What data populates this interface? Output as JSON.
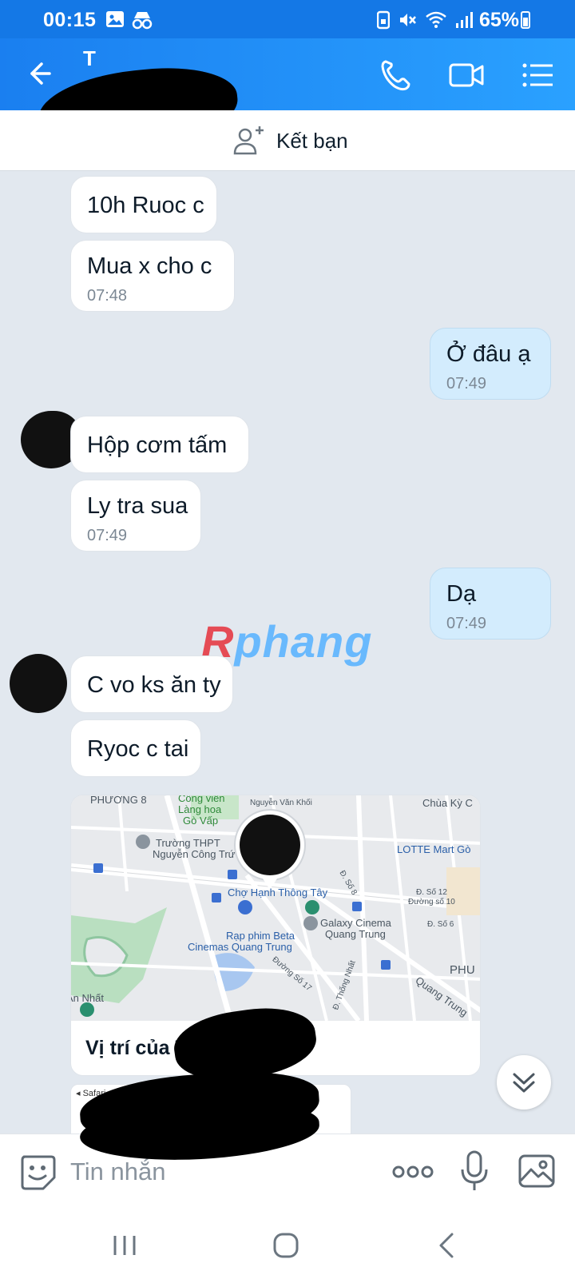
{
  "status_bar": {
    "time": "00:15",
    "battery": "65%"
  },
  "header": {
    "contact_name": "T"
  },
  "friend_bar": {
    "label": "Kết bạn"
  },
  "messages": [
    {
      "dir": "in",
      "text": "10h Ruoc c",
      "time": ""
    },
    {
      "dir": "in",
      "text": "Mua x cho c",
      "time": "07:48"
    },
    {
      "dir": "out",
      "text": "Ở đâu ạ",
      "time": "07:49"
    },
    {
      "dir": "in",
      "text": "Hộp cơm tấm",
      "time": ""
    },
    {
      "dir": "in",
      "text": "Ly tra sua",
      "time": "07:49"
    },
    {
      "dir": "out",
      "text": "Dạ",
      "time": "07:49"
    },
    {
      "dir": "in",
      "text": "C vo ks ăn ty",
      "time": ""
    },
    {
      "dir": "in",
      "text": "Ryoc c tai",
      "time": ""
    }
  ],
  "location_card": {
    "caption": "Vị trí của T",
    "map_labels": {
      "phuong8": "PHƯỜNG 8",
      "cong_vien": "Công viên",
      "lang_hoa": "Làng hoa",
      "go_vap": "Gò Vấp",
      "nguyen_van_khoi": "Nguyễn Văn Khối",
      "chua_ky_c": "Chùa Kỳ C",
      "truong_thpt": "Trường THPT",
      "nguyen_cong_tru": "Nguyễn Công Trứ",
      "lotte": "LOTTE Mart Gò",
      "cho_hong_tay": "Chợ Hạnh Thông Tây",
      "duong_so8": "Đ. Số 8",
      "duong_so12": "Đ. Số 12",
      "duong_so10": "Đường số 10",
      "duong_so6": "Đ. Số 6",
      "rap_phim": "Rạp phim Beta",
      "cinemas": "Cinemas Quang Trung",
      "galaxy": "Galaxy Cinema",
      "galaxy2": "Quang Trung",
      "phu": "PHU",
      "duong_so17": "Đường Số 17",
      "thong_nhat": "Đ. Thống Nhất",
      "quang_trung": "Quang Trung",
      "an_nhat": "An Nhất"
    }
  },
  "preview_card": {
    "safari_text": "◂ Safari"
  },
  "watermark": {
    "r": "R",
    "rest": "phang"
  },
  "input_bar": {
    "placeholder": "Tin nhắn"
  },
  "colors": {
    "header": "#1a7ff0",
    "outgoing_bubble": "#d3ecfd",
    "chat_bg": "#e2e8ef"
  },
  "icons": [
    "back-arrow-icon",
    "phone-icon",
    "video-camera-icon",
    "list-menu-icon",
    "add-friend-icon",
    "chevron-double-down-icon",
    "sticker-smile-icon",
    "more-dots-icon",
    "microphone-icon",
    "image-gallery-icon",
    "recent-apps-icon",
    "home-icon",
    "back-icon"
  ]
}
